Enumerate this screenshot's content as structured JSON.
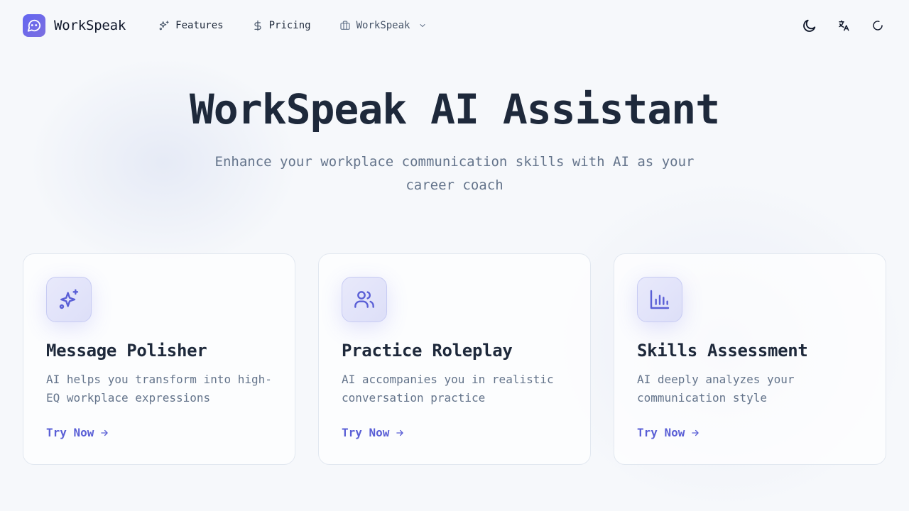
{
  "brand": {
    "name": "WorkSpeak",
    "accent": "#6366f1"
  },
  "nav": {
    "features": "Features",
    "pricing": "Pricing",
    "workspeak": "WorkSpeak"
  },
  "hero": {
    "title": "WorkSpeak AI Assistant",
    "subtitle": "Enhance your workplace communication skills with AI as your career coach"
  },
  "cards": [
    {
      "icon": "sparkles-icon",
      "title": "Message Polisher",
      "description": "AI helps you transform into high-EQ workplace expressions",
      "cta": "Try Now"
    },
    {
      "icon": "users-icon",
      "title": "Practice Roleplay",
      "description": "AI accompanies you in realistic conversation practice",
      "cta": "Try Now"
    },
    {
      "icon": "bar-chart-icon",
      "title": "Skills Assessment",
      "description": "AI deeply analyzes your communication style",
      "cta": "Try Now"
    }
  ]
}
